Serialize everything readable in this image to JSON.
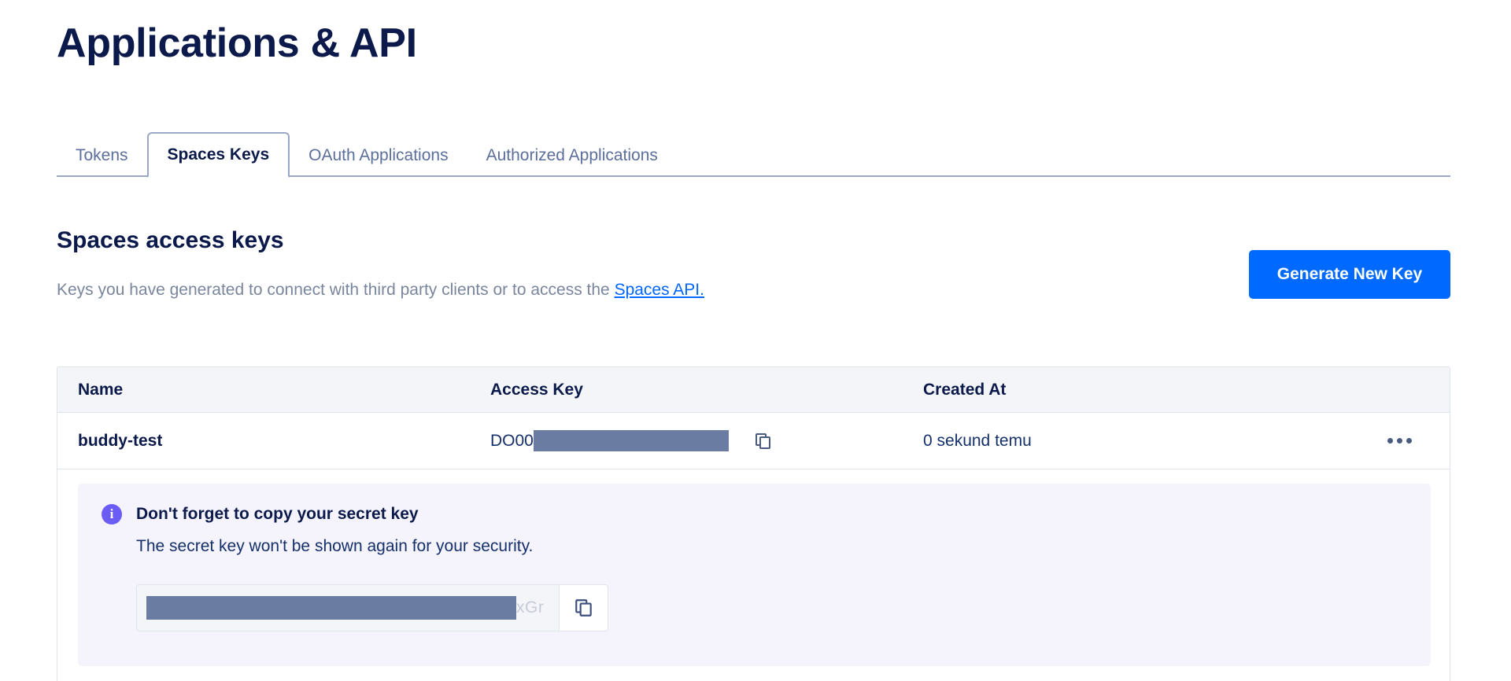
{
  "page": {
    "title": "Applications & API"
  },
  "tabs": [
    {
      "label": "Tokens",
      "active": false
    },
    {
      "label": "Spaces Keys",
      "active": true
    },
    {
      "label": "OAuth Applications",
      "active": false
    },
    {
      "label": "Authorized Applications",
      "active": false
    }
  ],
  "section": {
    "heading": "Spaces access keys",
    "description_prefix": "Keys you have generated to connect with third party clients or to access the ",
    "description_link": "Spaces API.",
    "generate_button": "Generate New Key"
  },
  "table": {
    "columns": [
      "Name",
      "Access Key",
      "Created At"
    ],
    "rows": [
      {
        "name": "buddy-test",
        "access_key_prefix": "DO00",
        "access_key_redacted": true,
        "copy_icon": "copy-icon",
        "created_at": "0 sekund temu",
        "menu_icon": "ellipsis-icon"
      }
    ]
  },
  "info_panel": {
    "icon": "info-circle-icon",
    "title": "Don't forget to copy your secret key",
    "subtitle": "The secret key won't be shown again for your security.",
    "secret_field": {
      "redacted": true,
      "visible_tail": "xGr",
      "copy_icon": "copy-icon"
    }
  },
  "colors": {
    "title": "#0b1a4a",
    "accent_blue": "#0069ff",
    "link_blue": "#0066ff",
    "muted_text": "#7a869e",
    "redaction": "#6b7ca3",
    "info_icon": "#6b5cf6",
    "info_bg": "#f5f4fd",
    "table_header_bg": "#f3f5f9",
    "border": "#dfe3ea",
    "tab_border": "#9aa7c7"
  }
}
